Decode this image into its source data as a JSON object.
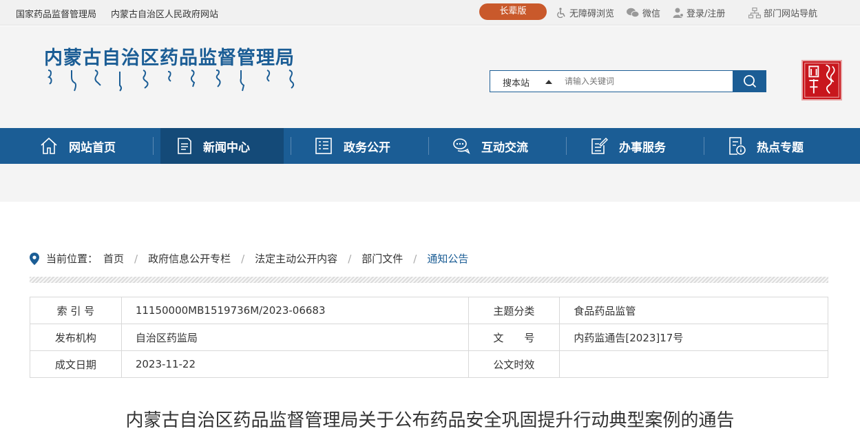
{
  "topbar": {
    "site1": "国家药品监督管理局",
    "site2": "内蒙古自治区人民政府网站",
    "elder": "长辈版",
    "accessible": "无障碍浏览",
    "wechat": "微信",
    "login": "登录/注册",
    "nav_guide": "部门网站导航"
  },
  "header": {
    "logo_text": "内蒙古自治区药品监督管理局",
    "search_scope": "搜本站",
    "search_placeholder": "请输入关键词"
  },
  "nav": {
    "items": [
      {
        "label": "网站首页",
        "icon": "home-icon"
      },
      {
        "label": "新闻中心",
        "icon": "document-icon"
      },
      {
        "label": "政务公开",
        "icon": "list-icon"
      },
      {
        "label": "互动交流",
        "icon": "chat-icon"
      },
      {
        "label": "办事服务",
        "icon": "edit-icon"
      },
      {
        "label": "热点专题",
        "icon": "info-doc-icon"
      }
    ],
    "active": "新闻中心"
  },
  "breadcrumb": {
    "prefix": "当前位置：",
    "items": [
      "首页",
      "政府信息公开专栏",
      "法定主动公开内容",
      "部门文件",
      "通知公告"
    ]
  },
  "info": {
    "index_label": "索 引 号",
    "index_value": "11150000MB1519736M/2023-06683",
    "topic_label": "主题分类",
    "topic_value": "食品药品监管",
    "publisher_label": "发布机构",
    "publisher_value": "自治区药监局",
    "docno_label": "文　　号",
    "docno_value": "内药监通告[2023]17号",
    "date_label": "成文日期",
    "date_value": "2023-11-22",
    "validity_label": "公文时效",
    "validity_value": ""
  },
  "document": {
    "title": "内蒙古自治区药品监督管理局关于公布药品安全巩固提升行动典型案例的通告"
  },
  "colors": {
    "brand_blue": "#1b5d95",
    "elder_orange": "#c9592b",
    "seal_red": "#c8161d"
  }
}
